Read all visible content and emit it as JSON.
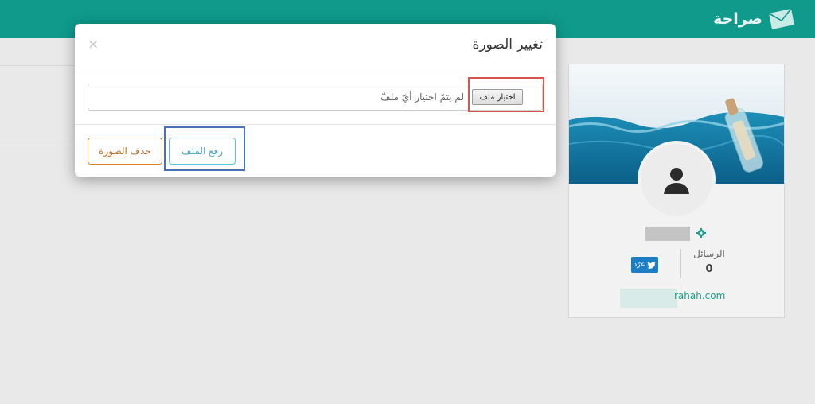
{
  "app": {
    "brand_name": "صراحة"
  },
  "modal": {
    "title": "تغيير الصورة",
    "close_symbol": "×",
    "file_input": {
      "choose_button_label": "اختيار ملف",
      "status_text": "لم يتمّ اختيار أيّ ملفّ"
    },
    "upload_button_label": "رفع الملف",
    "delete_button_label": "حذف الصورة"
  },
  "profile": {
    "messages_label": "الرسائل",
    "messages_count": "0",
    "twitter_button_label": "غرّد",
    "link_text": "rahah.com"
  },
  "colors": {
    "brand": "#0f9a8b",
    "upload_accent": "#5bc0de",
    "delete_accent": "#d9822b",
    "highlight_red": "#d9534f",
    "highlight_blue": "#4a70b8"
  }
}
